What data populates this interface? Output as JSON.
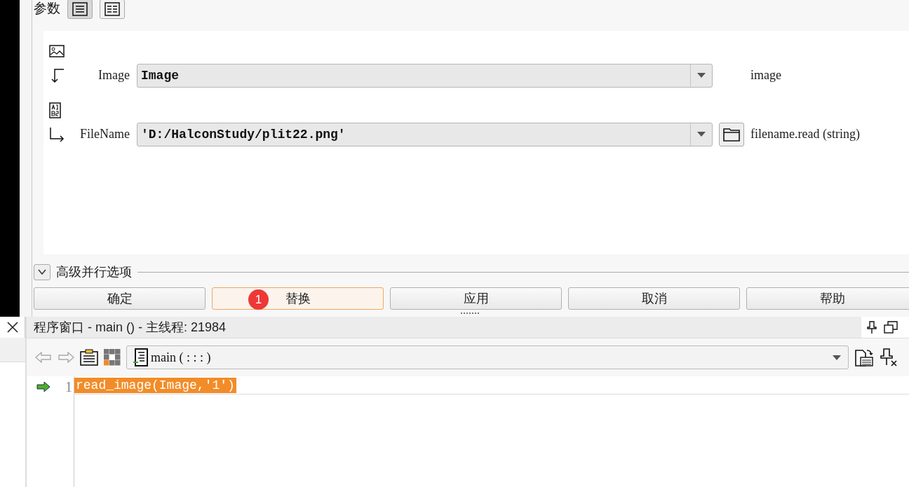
{
  "params_panel": {
    "title": "参数",
    "view_buttons": [
      {
        "selected": true
      },
      {
        "selected": false
      }
    ],
    "params": [
      {
        "kind": "iconic",
        "name": "Image",
        "value": "Image",
        "hint": "image",
        "browse": false
      },
      {
        "kind": "control",
        "name": "FileName",
        "value": "'D:/HalconStudy/plit22.png'",
        "hint": "filename.read (string)",
        "browse": true
      }
    ]
  },
  "advanced": {
    "label": "高级并行选项",
    "expanded": false
  },
  "buttons": [
    {
      "label": "确定",
      "highlighted": false
    },
    {
      "label": "替换",
      "highlighted": true,
      "badge": "1"
    },
    {
      "label": "应用",
      "highlighted": false
    },
    {
      "label": "取消",
      "highlighted": false
    },
    {
      "label": "帮助",
      "highlighted": false
    }
  ],
  "program_window": {
    "title": "程序窗口 - main () - 主线程: 21984",
    "procedure": "main ( : : : )",
    "lines": [
      {
        "number": "1",
        "code": "read_image(Image,'1')",
        "current": true,
        "selected": true
      }
    ]
  }
}
